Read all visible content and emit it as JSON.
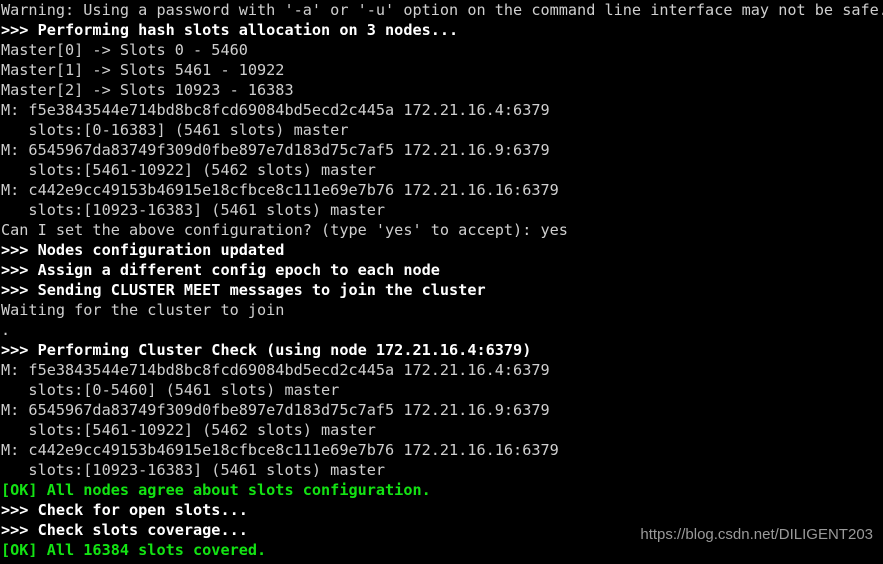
{
  "terminal": {
    "background_color": "#000000",
    "plain_text_color": "#cfcfcf",
    "bold_text_color": "#ffffff",
    "ok_text_color": "#13e313",
    "lines": [
      {
        "text": "Warning: Using a password with '-a' or '-u' option on the command line interface may not be safe.",
        "style": "plain"
      },
      {
        "text": ">>> Performing hash slots allocation on 3 nodes...",
        "style": "bold"
      },
      {
        "text": "Master[0] -> Slots 0 - 5460",
        "style": "plain"
      },
      {
        "text": "Master[1] -> Slots 5461 - 10922",
        "style": "plain"
      },
      {
        "text": "Master[2] -> Slots 10923 - 16383",
        "style": "plain"
      },
      {
        "text": "M: f5e3843544e714bd8bc8fcd69084bd5ecd2c445a 172.21.16.4:6379",
        "style": "plain"
      },
      {
        "text": "   slots:[0-16383] (5461 slots) master",
        "style": "plain"
      },
      {
        "text": "M: 6545967da83749f309d0fbe897e7d183d75c7af5 172.21.16.9:6379",
        "style": "plain"
      },
      {
        "text": "   slots:[5461-10922] (5462 slots) master",
        "style": "plain"
      },
      {
        "text": "M: c442e9cc49153b46915e18cfbce8c111e69e7b76 172.21.16.16:6379",
        "style": "plain"
      },
      {
        "text": "   slots:[10923-16383] (5461 slots) master",
        "style": "plain"
      },
      {
        "text": "Can I set the above configuration? (type 'yes' to accept): yes",
        "style": "plain"
      },
      {
        "text": ">>> Nodes configuration updated",
        "style": "bold"
      },
      {
        "text": ">>> Assign a different config epoch to each node",
        "style": "bold"
      },
      {
        "text": ">>> Sending CLUSTER MEET messages to join the cluster",
        "style": "bold"
      },
      {
        "text": "Waiting for the cluster to join",
        "style": "plain"
      },
      {
        "text": ".",
        "style": "plain"
      },
      {
        "text": ">>> Performing Cluster Check (using node 172.21.16.4:6379)",
        "style": "bold"
      },
      {
        "text": "M: f5e3843544e714bd8bc8fcd69084bd5ecd2c445a 172.21.16.4:6379",
        "style": "plain"
      },
      {
        "text": "   slots:[0-5460] (5461 slots) master",
        "style": "plain"
      },
      {
        "text": "M: 6545967da83749f309d0fbe897e7d183d75c7af5 172.21.16.9:6379",
        "style": "plain"
      },
      {
        "text": "   slots:[5461-10922] (5462 slots) master",
        "style": "plain"
      },
      {
        "text": "M: c442e9cc49153b46915e18cfbce8c111e69e7b76 172.21.16.16:6379",
        "style": "plain"
      },
      {
        "text": "   slots:[10923-16383] (5461 slots) master",
        "style": "plain"
      },
      {
        "text": "[OK] All nodes agree about slots configuration.",
        "style": "ok"
      },
      {
        "text": ">>> Check for open slots...",
        "style": "bold"
      },
      {
        "text": ">>> Check slots coverage...",
        "style": "bold"
      },
      {
        "text": "[OK] All 16384 slots covered.",
        "style": "ok"
      }
    ]
  },
  "watermark": {
    "text": "https://blog.csdn.net/DILIGENT203",
    "color": "#9a9a9a"
  }
}
